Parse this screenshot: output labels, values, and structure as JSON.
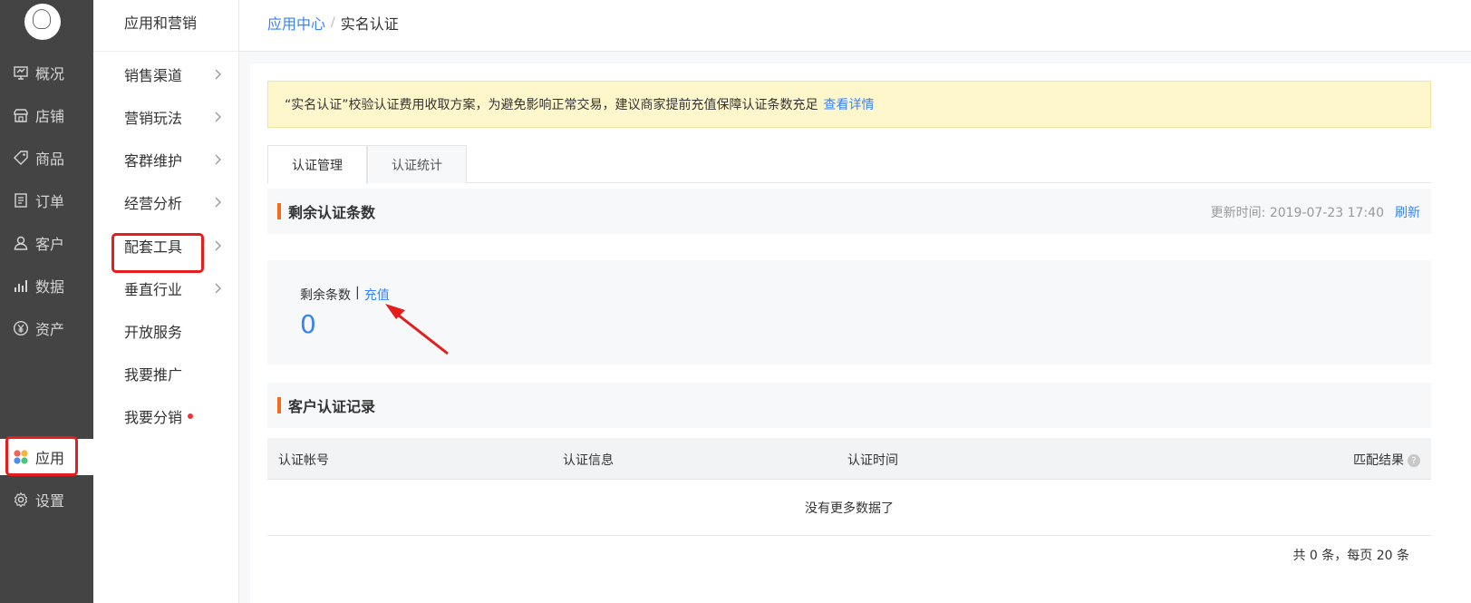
{
  "sidebar": {
    "items": [
      {
        "label": "概况",
        "icon": "monitor-icon"
      },
      {
        "label": "店铺",
        "icon": "store-icon"
      },
      {
        "label": "商品",
        "icon": "tag-icon"
      },
      {
        "label": "订单",
        "icon": "document-icon"
      },
      {
        "label": "客户",
        "icon": "person-icon"
      },
      {
        "label": "数据",
        "icon": "bar-chart-icon"
      },
      {
        "label": "资产",
        "icon": "yen-icon"
      },
      {
        "label": "应用",
        "icon": "apps-icon"
      },
      {
        "label": "设置",
        "icon": "gear-icon"
      }
    ],
    "active": "应用"
  },
  "subnav": {
    "title": "应用和营销",
    "items": [
      {
        "label": "销售渠道"
      },
      {
        "label": "营销玩法"
      },
      {
        "label": "客群维护"
      },
      {
        "label": "经营分析"
      },
      {
        "label": "配套工具"
      },
      {
        "label": "垂直行业"
      },
      {
        "label": "开放服务"
      },
      {
        "label": "我要推广"
      },
      {
        "label": "我要分销"
      }
    ]
  },
  "breadcrumb": {
    "parent": "应用中心",
    "separator": "/",
    "current": "实名认证"
  },
  "notice": {
    "text": "“实名认证”校验认证费用收取方案，为避免影响正常交易，建议商家提前充值保障认证条数充足",
    "link": "查看详情"
  },
  "tabs": [
    {
      "label": "认证管理"
    },
    {
      "label": "认证统计"
    }
  ],
  "remain_section": {
    "title": "剩余认证条数",
    "update_time": "更新时间: 2019-07-23 17:40",
    "refresh": "刷新",
    "label": "剩余条数",
    "divider": "|",
    "recharge": "充值",
    "count": "0"
  },
  "records_section": {
    "title": "客户认证记录",
    "columns": [
      "认证帐号",
      "认证信息",
      "认证时间",
      "匹配结果"
    ],
    "help": "?",
    "empty": "没有更多数据了",
    "pager": "共 0 条，每页 20 条"
  },
  "colors": {
    "accent": "#3883fa",
    "sidebar": "#444444",
    "highlight": "#e51d1d",
    "section_bar": "#f36b1b",
    "notice_bg": "#fff7cc"
  }
}
